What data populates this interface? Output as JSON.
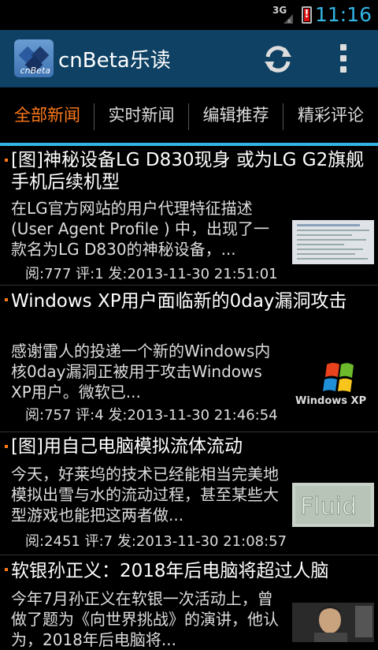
{
  "status": {
    "network": "3G",
    "time": "11:16",
    "battery_alert": "!"
  },
  "app": {
    "title": "cnBeta乐读",
    "logo_text": "cnBeta"
  },
  "tabs": [
    {
      "label": "全部新闻"
    },
    {
      "label": "实时新闻"
    },
    {
      "label": "编辑推荐"
    },
    {
      "label": "精彩评论"
    }
  ],
  "news": [
    {
      "title": "[图]神秘设备LG D830现身 或为LG G2旗舰手机后续机型",
      "summary": "在LG官方网站的用户代理特征描述(User Agent Profile ) 中，出现了一款名为LG D830的神秘设备，...",
      "meta": "阅:777 评:1 发:2013-11-30 21:51:01",
      "thumb_icon": "screenshot-thumbnail"
    },
    {
      "title": "Windows XP用户面临新的0day漏洞攻击",
      "summary": "感谢雷人的投递一个新的Windows内核0day漏洞正被用于攻击Windows XP用户。微软已...",
      "meta": "阅:757 评:4 发:2013-11-30 21:46:54",
      "thumb_icon": "windows-xp-logo",
      "thumb_text": "Windows XP"
    },
    {
      "title": "[图]用自己电脑模拟流体流动",
      "summary": "今天，好莱坞的技术已经能相当完美地模拟出雪与水的流动过程，甚至某些大型游戏也能把这两者做...",
      "meta": "阅:2451 评:7 发:2013-11-30 21:08:57",
      "thumb_icon": "fluid-thumbnail",
      "thumb_text": "Fluid"
    },
    {
      "title": "软银孙正义：2018年后电脑将超过人脑",
      "summary": "今年7月孙正义在软银一次活动上，曾做了题为《向世界挑战》的演讲，他认为，2018年后电脑将...",
      "thumb_icon": "person-photo-thumbnail"
    }
  ]
}
